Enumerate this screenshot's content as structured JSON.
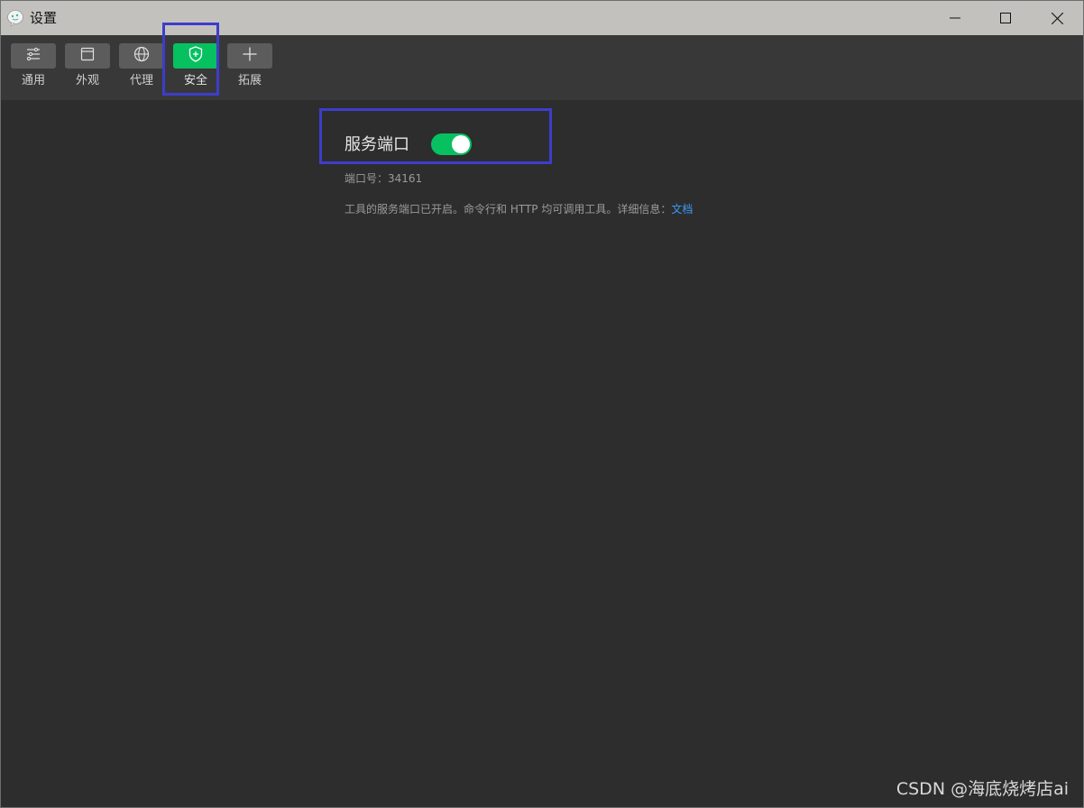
{
  "window": {
    "title": "设置",
    "app_icon": "wechat-devtools-icon",
    "controls": {
      "minimize_icon": "minimize-icon",
      "maximize_icon": "maximize-icon",
      "close_icon": "close-icon"
    }
  },
  "toolbar": {
    "tabs": [
      {
        "label": "通用",
        "icon": "sliders-icon",
        "active": false
      },
      {
        "label": "外观",
        "icon": "window-icon",
        "active": false
      },
      {
        "label": "代理",
        "icon": "globe-icon",
        "active": false
      },
      {
        "label": "安全",
        "icon": "shield-icon",
        "active": true
      },
      {
        "label": "拓展",
        "icon": "plus-icon",
        "active": false
      }
    ]
  },
  "security": {
    "service_port_title": "服务端口",
    "service_port_enabled": true,
    "port_label": "端口号：",
    "port_value": "34161",
    "description": "工具的服务端口已开启。命令行和 HTTP 均可调用工具。详细信息：",
    "doc_link": "文档"
  },
  "colors": {
    "accent_green": "#07c160",
    "annotation_blue": "#3d3dcc",
    "link_blue": "#3d9bf5"
  },
  "watermark": "CSDN @海底烧烤店ai"
}
